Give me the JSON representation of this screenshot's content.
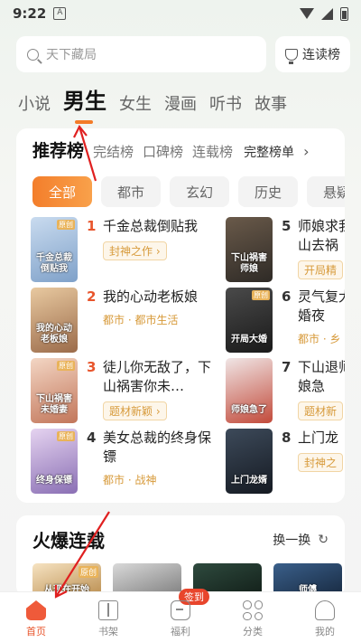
{
  "status": {
    "time": "9:22",
    "notif": "A"
  },
  "search": {
    "placeholder": "天下藏局",
    "readlist_label": "连读榜"
  },
  "category_tabs": [
    {
      "label": "小说",
      "active": false
    },
    {
      "label": "男生",
      "active": true
    },
    {
      "label": "女生",
      "active": false
    },
    {
      "label": "漫画",
      "active": false
    },
    {
      "label": "听书",
      "active": false
    },
    {
      "label": "故事",
      "active": false
    }
  ],
  "ranking": {
    "title": "推荐榜",
    "tabs": [
      "完结榜",
      "口碑榜",
      "连载榜"
    ],
    "full_label": "完整榜单",
    "chev": "›",
    "chips": [
      "全部",
      "都市",
      "玄幻",
      "历史",
      "悬疑"
    ],
    "books": [
      {
        "rank": "1",
        "title": "千金总裁倒贴我",
        "tag": "封神之作 ›",
        "cover_text": "千金总裁倒贴我",
        "badge": "原创"
      },
      {
        "rank": "2",
        "title": "我的心动老板娘",
        "tag": "都市 · 都市生活",
        "cover_text": "我的心动老板娘",
        "badge": ""
      },
      {
        "rank": "3",
        "title": "徒儿你无敌了，下山祸害你未…",
        "tag": "题材新颖 ›",
        "cover_text": "下山祸害未婚妻",
        "badge": "原创"
      },
      {
        "rank": "4",
        "title": "美女总裁的终身保镖",
        "tag": "都市 · 战神",
        "cover_text": "终身保镖",
        "badge": "原创"
      },
      {
        "rank": "5",
        "title": "师娘求我山去祸",
        "tag": "开局精",
        "cover_text": "下山祸害师娘",
        "badge": ""
      },
      {
        "rank": "6",
        "title": "灵气复大婚夜",
        "tag": "都市 · 乡",
        "cover_text": "开局大婚",
        "badge": "原创"
      },
      {
        "rank": "7",
        "title": "下山退师娘急",
        "tag": "题材新",
        "cover_text": "师娘急了",
        "badge": ""
      },
      {
        "rank": "8",
        "title": "上门龙",
        "tag": "封神之",
        "cover_text": "上门龙婿",
        "badge": ""
      }
    ]
  },
  "hot": {
    "title": "火爆连载",
    "switch_label": "换一换",
    "refresh_icon": "↻",
    "covers": [
      {
        "badge": "原创",
        "text": "从现在开始"
      },
      {
        "badge": "",
        "text": ""
      },
      {
        "badge": "",
        "text": ""
      },
      {
        "badge": "",
        "text": "师傅"
      }
    ]
  },
  "nav": [
    {
      "label": "首页",
      "active": true,
      "icon": "home-icon"
    },
    {
      "label": "书架",
      "active": false,
      "icon": "bookshelf-icon"
    },
    {
      "label": "福利",
      "active": false,
      "icon": "gift-icon",
      "badge": "签到"
    },
    {
      "label": "分类",
      "active": false,
      "icon": "category-icon"
    },
    {
      "label": "我的",
      "active": false,
      "icon": "profile-icon"
    }
  ],
  "colors": {
    "accent": "#f37b28",
    "rank_hot": "#e8552c",
    "annotation": "#e02020"
  }
}
